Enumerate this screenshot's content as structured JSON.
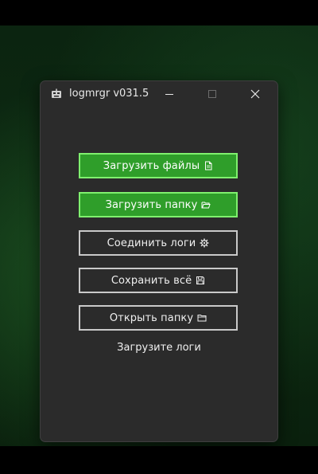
{
  "window": {
    "title": "logmrgr v031.5"
  },
  "buttons": {
    "load_files": {
      "label": "Загрузить файлы",
      "icon": "file-icon"
    },
    "load_folder": {
      "label": "Загрузить папку",
      "icon": "folder-open-icon"
    },
    "merge_logs": {
      "label": "Соединить логи",
      "icon": "gear-icon"
    },
    "save_all": {
      "label": "Сохранить всё",
      "icon": "floppy-disk-icon"
    },
    "open_folder": {
      "label": "Открыть папку",
      "icon": "folder-icon"
    }
  },
  "status": {
    "text": "Загрузите логи"
  },
  "colors": {
    "primary_fill": "#2f9e2a",
    "primary_border": "#7ff06e",
    "window_bg": "#2b2b2b",
    "secondary_border": "#c9c9c9"
  }
}
